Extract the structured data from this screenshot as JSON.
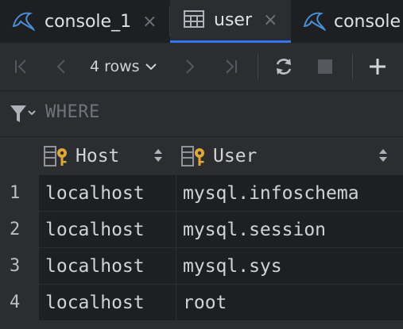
{
  "tabs": [
    {
      "label": "console_1",
      "close": "×",
      "icon": "mysql-console-icon",
      "active": false
    },
    {
      "label": "user",
      "close": "×",
      "icon": "table-icon",
      "active": true
    },
    {
      "label": "console",
      "icon": "mysql-console-icon",
      "active": false
    }
  ],
  "toolbar": {
    "rows_label": "4 rows",
    "buttons": [
      "first-page-icon",
      "previous-page-icon",
      "next-page-icon",
      "last-page-icon",
      "reload-icon",
      "stop-icon",
      "add-row-icon"
    ]
  },
  "filter": {
    "placeholder": "WHERE",
    "icon": "filter-icon"
  },
  "table": {
    "columns": [
      {
        "name": "Host",
        "icon": "primary-key-column-icon"
      },
      {
        "name": "User",
        "icon": "primary-key-column-icon"
      }
    ],
    "rows": [
      {
        "num": "1",
        "host": "localhost",
        "user": "mysql.infoschema"
      },
      {
        "num": "2",
        "host": "localhost",
        "user": "mysql.session"
      },
      {
        "num": "3",
        "host": "localhost",
        "user": "mysql.sys"
      },
      {
        "num": "4",
        "host": "localhost",
        "user": "root"
      }
    ]
  },
  "colors": {
    "accent": "#3574f0",
    "background": "#2b2d30",
    "cell_background": "#1e1f22",
    "key_icon": "#e0a83b"
  }
}
